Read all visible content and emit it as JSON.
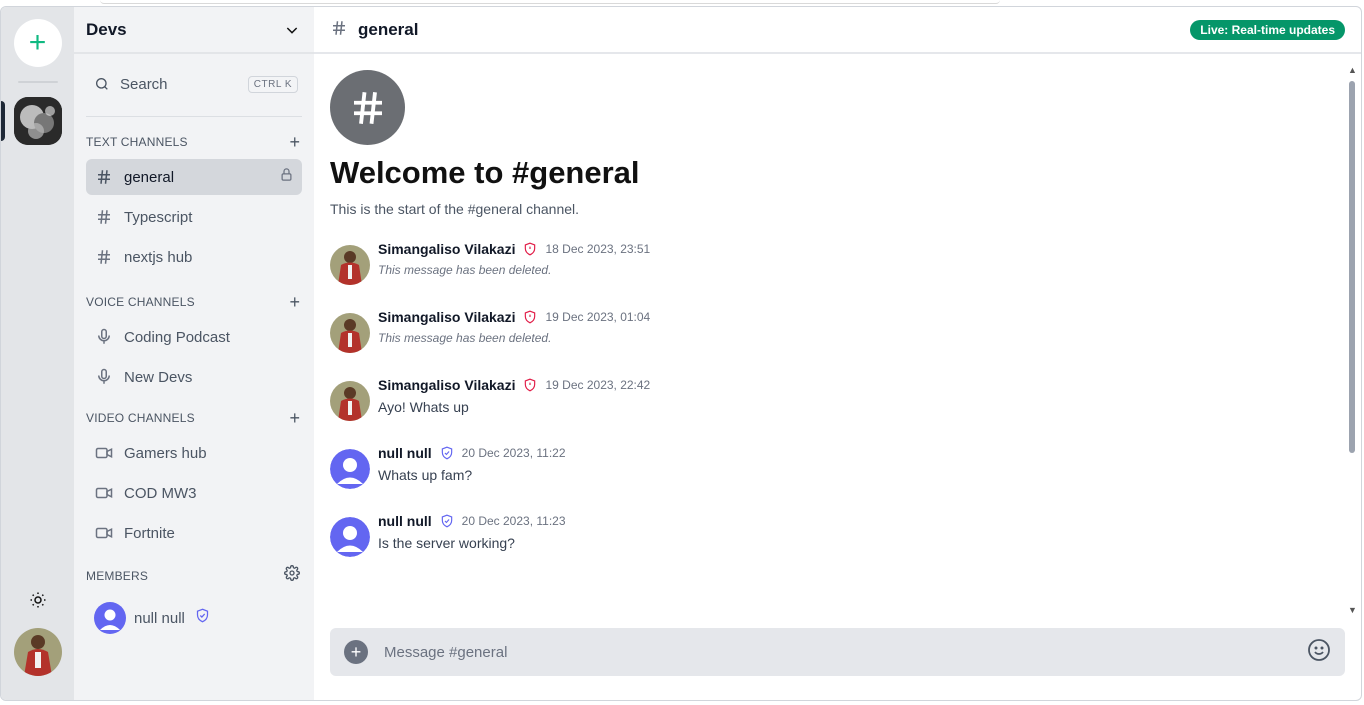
{
  "server": {
    "name": "Devs"
  },
  "search": {
    "label": "Search",
    "shortcut": "CTRL K"
  },
  "sections": {
    "text": "TEXT CHANNELS",
    "voice": "VOICE CHANNELS",
    "video": "VIDEO CHANNELS",
    "members": "MEMBERS"
  },
  "text_channels": [
    {
      "name": "general",
      "icon": "hash-icon",
      "active": true,
      "locked": true
    },
    {
      "name": "Typescript",
      "icon": "hash-icon"
    },
    {
      "name": "nextjs hub",
      "icon": "hash-icon"
    }
  ],
  "voice_channels": [
    {
      "name": "Coding Podcast",
      "icon": "mic-icon"
    },
    {
      "name": "New Devs",
      "icon": "mic-icon"
    }
  ],
  "video_channels": [
    {
      "name": "Gamers hub",
      "icon": "video-icon"
    },
    {
      "name": "COD MW3",
      "icon": "video-icon"
    },
    {
      "name": "Fortnite",
      "icon": "video-icon"
    }
  ],
  "members": [
    {
      "name": "null null",
      "role_icon": "shield-check-icon"
    }
  ],
  "chat": {
    "header": "general",
    "live_badge": "Live: Real-time updates",
    "welcome_title": "Welcome to #general",
    "welcome_sub": "This is the start of the #general channel.",
    "composer_placeholder": "Message #general"
  },
  "messages": [
    {
      "author": "Simangaliso Vilakazi",
      "role": "admin",
      "time": "18 Dec 2023, 23:51",
      "text": "This message has been deleted.",
      "deleted": true
    },
    {
      "author": "Simangaliso Vilakazi",
      "role": "admin",
      "time": "19 Dec 2023, 01:04",
      "text": "This message has been deleted.",
      "deleted": true
    },
    {
      "author": "Simangaliso Vilakazi",
      "role": "admin",
      "time": "19 Dec 2023, 22:42",
      "text": "Ayo! Whats up",
      "deleted": false
    },
    {
      "author": "null null",
      "role": "moderator",
      "time": "20 Dec 2023, 11:22",
      "text": "Whats up fam?",
      "deleted": false
    },
    {
      "author": "null null",
      "role": "moderator",
      "time": "20 Dec 2023, 11:23",
      "text": "Is the server working?",
      "deleted": false
    }
  ],
  "colors": {
    "accent": "#10b981",
    "live_badge": "#059669",
    "admin_shield": "#e11d48",
    "mod_shield": "#6366f1",
    "default_avatar": "#6366f1"
  }
}
